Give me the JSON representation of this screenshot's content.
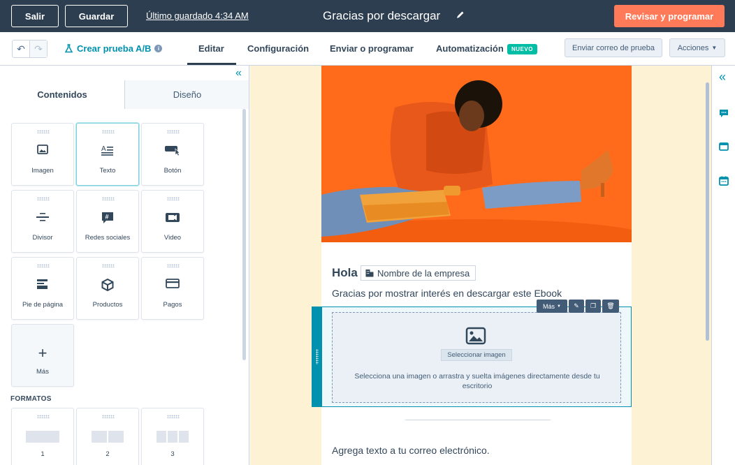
{
  "topbar": {
    "exit_label": "Salir",
    "save_label": "Guardar",
    "last_saved": "Último guardado 4:34 AM",
    "doc_title": "Gracias por descargar",
    "review_label": "Revisar y programar"
  },
  "toolbar": {
    "ab_test_label": "Crear prueba A/B",
    "tabs": [
      {
        "label": "Editar"
      },
      {
        "label": "Configuración"
      },
      {
        "label": "Enviar o programar"
      },
      {
        "label": "Automatización"
      }
    ],
    "new_badge": "NUEVO",
    "send_test_label": "Enviar correo de prueba",
    "actions_label": "Acciones"
  },
  "leftpanel": {
    "subtabs": [
      {
        "label": "Contenidos"
      },
      {
        "label": "Diseño"
      }
    ],
    "modules": [
      {
        "label": "Imagen",
        "icon": "image-icon"
      },
      {
        "label": "Texto",
        "icon": "text-icon"
      },
      {
        "label": "Botón",
        "icon": "button-icon"
      },
      {
        "label": "Divisor",
        "icon": "divider-icon"
      },
      {
        "label": "Redes sociales",
        "icon": "social-icon"
      },
      {
        "label": "Video",
        "icon": "video-icon"
      },
      {
        "label": "Pie de página",
        "icon": "footer-icon"
      },
      {
        "label": "Productos",
        "icon": "product-icon"
      },
      {
        "label": "Pagos",
        "icon": "payment-icon"
      },
      {
        "label": "Más",
        "icon": "plus-icon"
      }
    ],
    "formats_heading": "FORMATOS",
    "formats": [
      {
        "label": "1"
      },
      {
        "label": "2"
      },
      {
        "label": "3"
      }
    ]
  },
  "email": {
    "greeting": "Hola",
    "company_token": "Nombre de la empresa",
    "thanks_text": "Gracias por mostrar interés en descargar este Ebook",
    "module_more": "Más",
    "select_image_label": "Seleccionar imagen",
    "drop_text": "Selecciona una imagen o arrastra y suelta imágenes directamente desde tu escritorio",
    "add_text": "Agrega texto a tu correo electrónico."
  },
  "colors": {
    "topbar": "#2d3e50",
    "primary_cta": "#ff7a59",
    "accent": "#0091ae",
    "new_badge": "#00bda5",
    "canvas_bg": "#fdf2d3",
    "hero_bg": "#ff6b1a"
  }
}
